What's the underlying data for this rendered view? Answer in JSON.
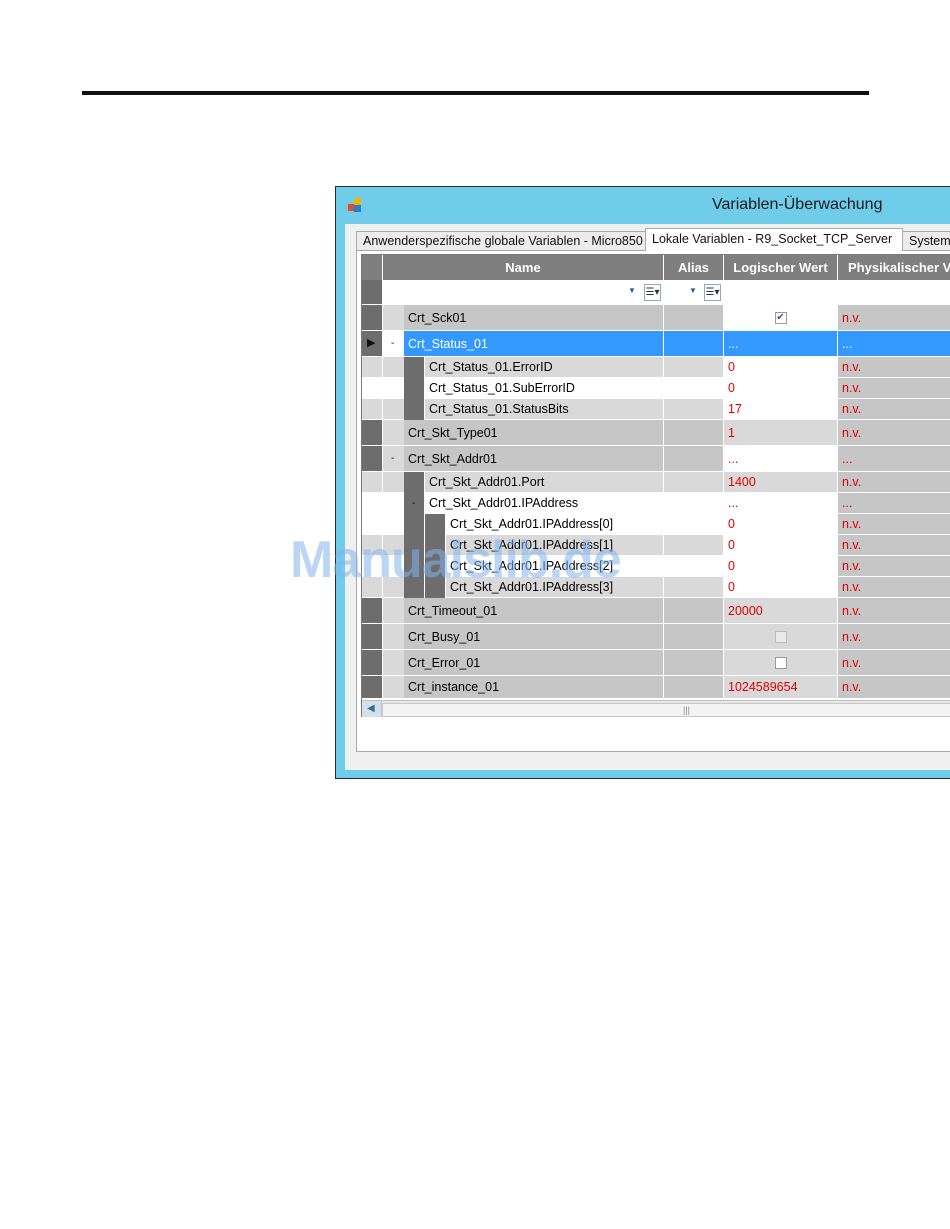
{
  "window": {
    "title": "Variablen-Überwachung"
  },
  "tabs": [
    {
      "label": "Anwenderspezifische globale Variablen - Micro850"
    },
    {
      "label": "Lokale Variablen - R9_Socket_TCP_Server"
    },
    {
      "label": "Systemv"
    }
  ],
  "columns": {
    "name": "Name",
    "alias": "Alias",
    "logical": "Logischer Wert",
    "physical": "Physikalischer V"
  },
  "rows": [
    {
      "name": "Crt_Sck01",
      "logical": "",
      "physical": "n.v.",
      "checkbox": "checked"
    },
    {
      "name": "Crt_Status_01",
      "logical": "...",
      "physical": "...",
      "expander": "-",
      "selected": true
    },
    {
      "name": "Crt_Status_01.ErrorID",
      "logical": "0",
      "physical": "n.v."
    },
    {
      "name": "Crt_Status_01.SubErrorID",
      "logical": "0",
      "physical": "n.v."
    },
    {
      "name": "Crt_Status_01.StatusBits",
      "logical": "17",
      "physical": "n.v."
    },
    {
      "name": "Crt_Skt_Type01",
      "logical": "1",
      "physical": "n.v."
    },
    {
      "name": "Crt_Skt_Addr01",
      "logical": "...",
      "physical": "...",
      "expander": "-"
    },
    {
      "name": "Crt_Skt_Addr01.Port",
      "logical": "1400",
      "physical": "n.v."
    },
    {
      "name": "Crt_Skt_Addr01.IPAddress",
      "logical": "...",
      "physical": "...",
      "expander": "-"
    },
    {
      "name": "Crt_Skt_Addr01.IPAddress[0]",
      "logical": "0",
      "physical": "n.v."
    },
    {
      "name": "Crt_Skt_Addr01.IPAddress[1]",
      "logical": "0",
      "physical": "n.v."
    },
    {
      "name": "Crt_Skt_Addr01.IPAddress[2]",
      "logical": "0",
      "physical": "n.v."
    },
    {
      "name": "Crt_Skt_Addr01.IPAddress[3]",
      "logical": "0",
      "physical": "n.v."
    },
    {
      "name": "Crt_Timeout_01",
      "logical": "20000",
      "physical": "n.v."
    },
    {
      "name": "Crt_Busy_01",
      "logical": "",
      "physical": "n.v.",
      "checkbox": "unchecked-disabled"
    },
    {
      "name": "Crt_Error_01",
      "logical": "",
      "physical": "n.v.",
      "checkbox": "unchecked"
    },
    {
      "name": "Crt_instance_01",
      "logical": "1024589654",
      "physical": "n.v."
    }
  ],
  "watermark": "Manualslib.de",
  "colors": {
    "title_bar": "#6fcdea",
    "selection": "#3399ff",
    "value_red": "#e00000"
  }
}
